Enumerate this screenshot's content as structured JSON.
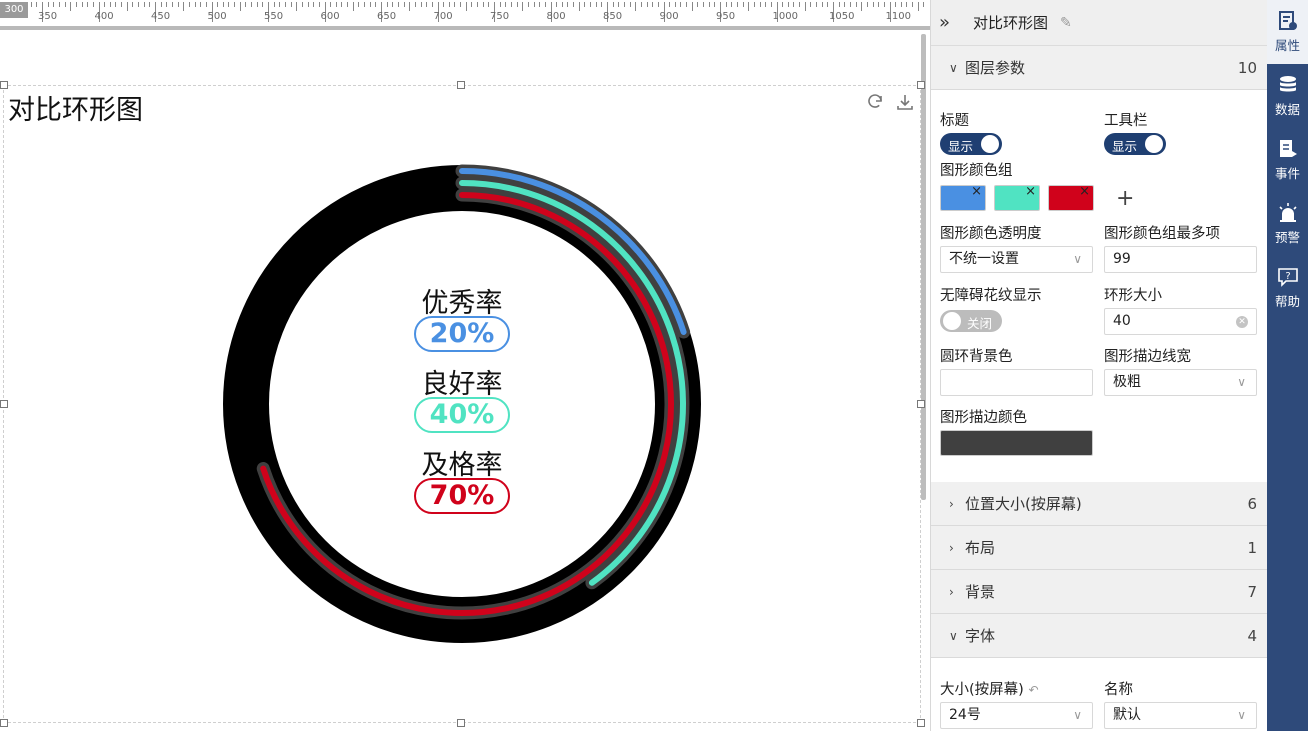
{
  "canvas": {
    "ruler": {
      "corner": "300",
      "labels": [
        "350",
        "400",
        "450",
        "500",
        "550",
        "600",
        "650",
        "700",
        "750",
        "800",
        "850",
        "900",
        "950",
        "1000",
        "1050",
        "1100"
      ]
    },
    "chart_title": "对比环形图"
  },
  "chart_data": {
    "type": "pie",
    "title": "对比环形图",
    "series": [
      {
        "name": "优秀率",
        "value": 20,
        "label": "20%",
        "color": "#4a90e2"
      },
      {
        "name": "良好率",
        "value": 40,
        "label": "40%",
        "color": "#50e3c2"
      },
      {
        "name": "及格率",
        "value": 70,
        "label": "70%",
        "color": "#d0021b"
      }
    ],
    "max": 100,
    "background_ring_color": "#000000",
    "stroke_color": "#404040"
  },
  "panel": {
    "title": "对比环形图",
    "sections": {
      "layer": {
        "label": "图层参数",
        "count": "10"
      },
      "position": {
        "label": "位置大小(按屏幕)",
        "count": "6"
      },
      "layout": {
        "label": "布局",
        "count": "1"
      },
      "background": {
        "label": "背景",
        "count": "7"
      },
      "font": {
        "label": "字体",
        "count": "4"
      }
    },
    "props": {
      "title_label": "标题",
      "title_toggle": "显示",
      "toolbar_label": "工具栏",
      "toolbar_toggle": "显示",
      "color_group_label": "图形颜色组",
      "color_group": [
        "#4a90e2",
        "#50e3c2",
        "#d0021b"
      ],
      "add": "+",
      "opacity_label": "图形颜色透明度",
      "opacity_value": "不统一设置",
      "max_items_label": "图形颜色组最多项",
      "max_items_value": "99",
      "pattern_label": "无障碍花纹显示",
      "pattern_toggle": "关闭",
      "ring_size_label": "环形大小",
      "ring_size_value": "40",
      "ring_bg_label": "圆环背景色",
      "stroke_width_label": "图形描边线宽",
      "stroke_width_value": "极粗",
      "stroke_color_label": "图形描边颜色",
      "font_size_label": "大小(按屏幕)",
      "font_size_value": "24号",
      "font_name_label": "名称",
      "font_name_value": "默认"
    }
  },
  "sidebar": {
    "items": [
      {
        "label": "属性",
        "icon": "properties-icon"
      },
      {
        "label": "数据",
        "icon": "database-icon"
      },
      {
        "label": "事件",
        "icon": "event-icon"
      },
      {
        "label": "预警",
        "icon": "alarm-icon"
      },
      {
        "label": "帮助",
        "icon": "help-icon"
      }
    ]
  }
}
